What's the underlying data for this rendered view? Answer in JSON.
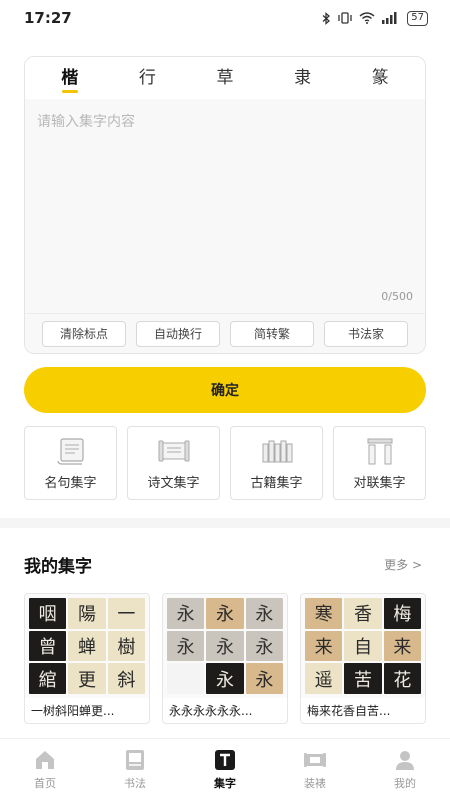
{
  "status": {
    "time": "17:27",
    "battery": "57"
  },
  "editor": {
    "tabs": [
      {
        "label": "楷",
        "active": true
      },
      {
        "label": "行",
        "active": false
      },
      {
        "label": "草",
        "active": false
      },
      {
        "label": "隶",
        "active": false
      },
      {
        "label": "篆",
        "active": false
      }
    ],
    "placeholder": "请输入集字内容",
    "char_count": "0/500",
    "tools": [
      "清除标点",
      "自动换行",
      "简转繁",
      "书法家"
    ]
  },
  "confirm_label": "确定",
  "categories": [
    {
      "label": "名句集字",
      "icon": "scroll-icon"
    },
    {
      "label": "诗文集字",
      "icon": "poem-scroll-icon"
    },
    {
      "label": "古籍集字",
      "icon": "bamboo-slips-icon"
    },
    {
      "label": "对联集字",
      "icon": "couplet-icon"
    }
  ],
  "my_collection": {
    "title": "我的集字",
    "more": "更多 >",
    "items": [
      {
        "caption": "一树斜阳蝉更...",
        "chars": [
          "咽",
          "陽",
          "一",
          "曾",
          "蝉",
          "樹",
          "綰",
          "更",
          "斜"
        ]
      },
      {
        "caption": "永永永永永永...",
        "chars": [
          "永",
          "永",
          "永",
          "永",
          "永",
          "永",
          "",
          "永",
          "永"
        ]
      },
      {
        "caption": "梅来花香自苦...",
        "chars": [
          "寒",
          "香",
          "梅",
          "来",
          "自",
          "来",
          "遥",
          "苦",
          "花"
        ]
      }
    ]
  },
  "tab_bar": [
    {
      "label": "首页",
      "icon": "home-icon",
      "active": false
    },
    {
      "label": "书法",
      "icon": "calligraphy-icon",
      "active": false
    },
    {
      "label": "集字",
      "icon": "collect-char-icon",
      "active": true
    },
    {
      "label": "装裱",
      "icon": "mounting-icon",
      "active": false
    },
    {
      "label": "我的",
      "icon": "profile-icon",
      "active": false
    }
  ],
  "colors": {
    "accent": "#f7ce00",
    "text": "#222222",
    "muted": "#999999"
  }
}
